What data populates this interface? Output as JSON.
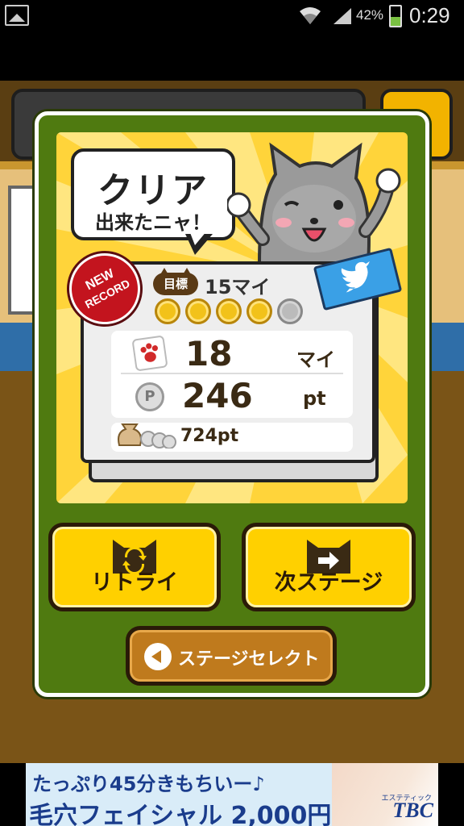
{
  "status_bar": {
    "battery": "42%",
    "time": "0:29"
  },
  "result": {
    "clear_title": "クリア",
    "clear_subtitle": "出来たニャ！",
    "new_record_line1": "NEW",
    "new_record_line2": "RECORD",
    "goal_label": "目標",
    "goal_value": "15マイ",
    "coins_earned": 4,
    "coins_total": 5,
    "count_value": "18",
    "count_unit": "マイ",
    "points_value": "246",
    "points_unit": "pt",
    "total_points": "724pt"
  },
  "buttons": {
    "retry": "リトライ",
    "next_stage": "次ステージ",
    "stage_select": "ステージセレクト"
  },
  "ad": {
    "line1": "たっぷり45分きもちいー♪",
    "line2": "毛穴フェイシャル 2,000円",
    "brand": "TBC",
    "brand_sub": "エステティック"
  },
  "colors": {
    "accent": "#ffd000",
    "dialog_frame": "#4f7a10",
    "new_record": "#c3141e",
    "twitter": "#3aa0e6"
  }
}
